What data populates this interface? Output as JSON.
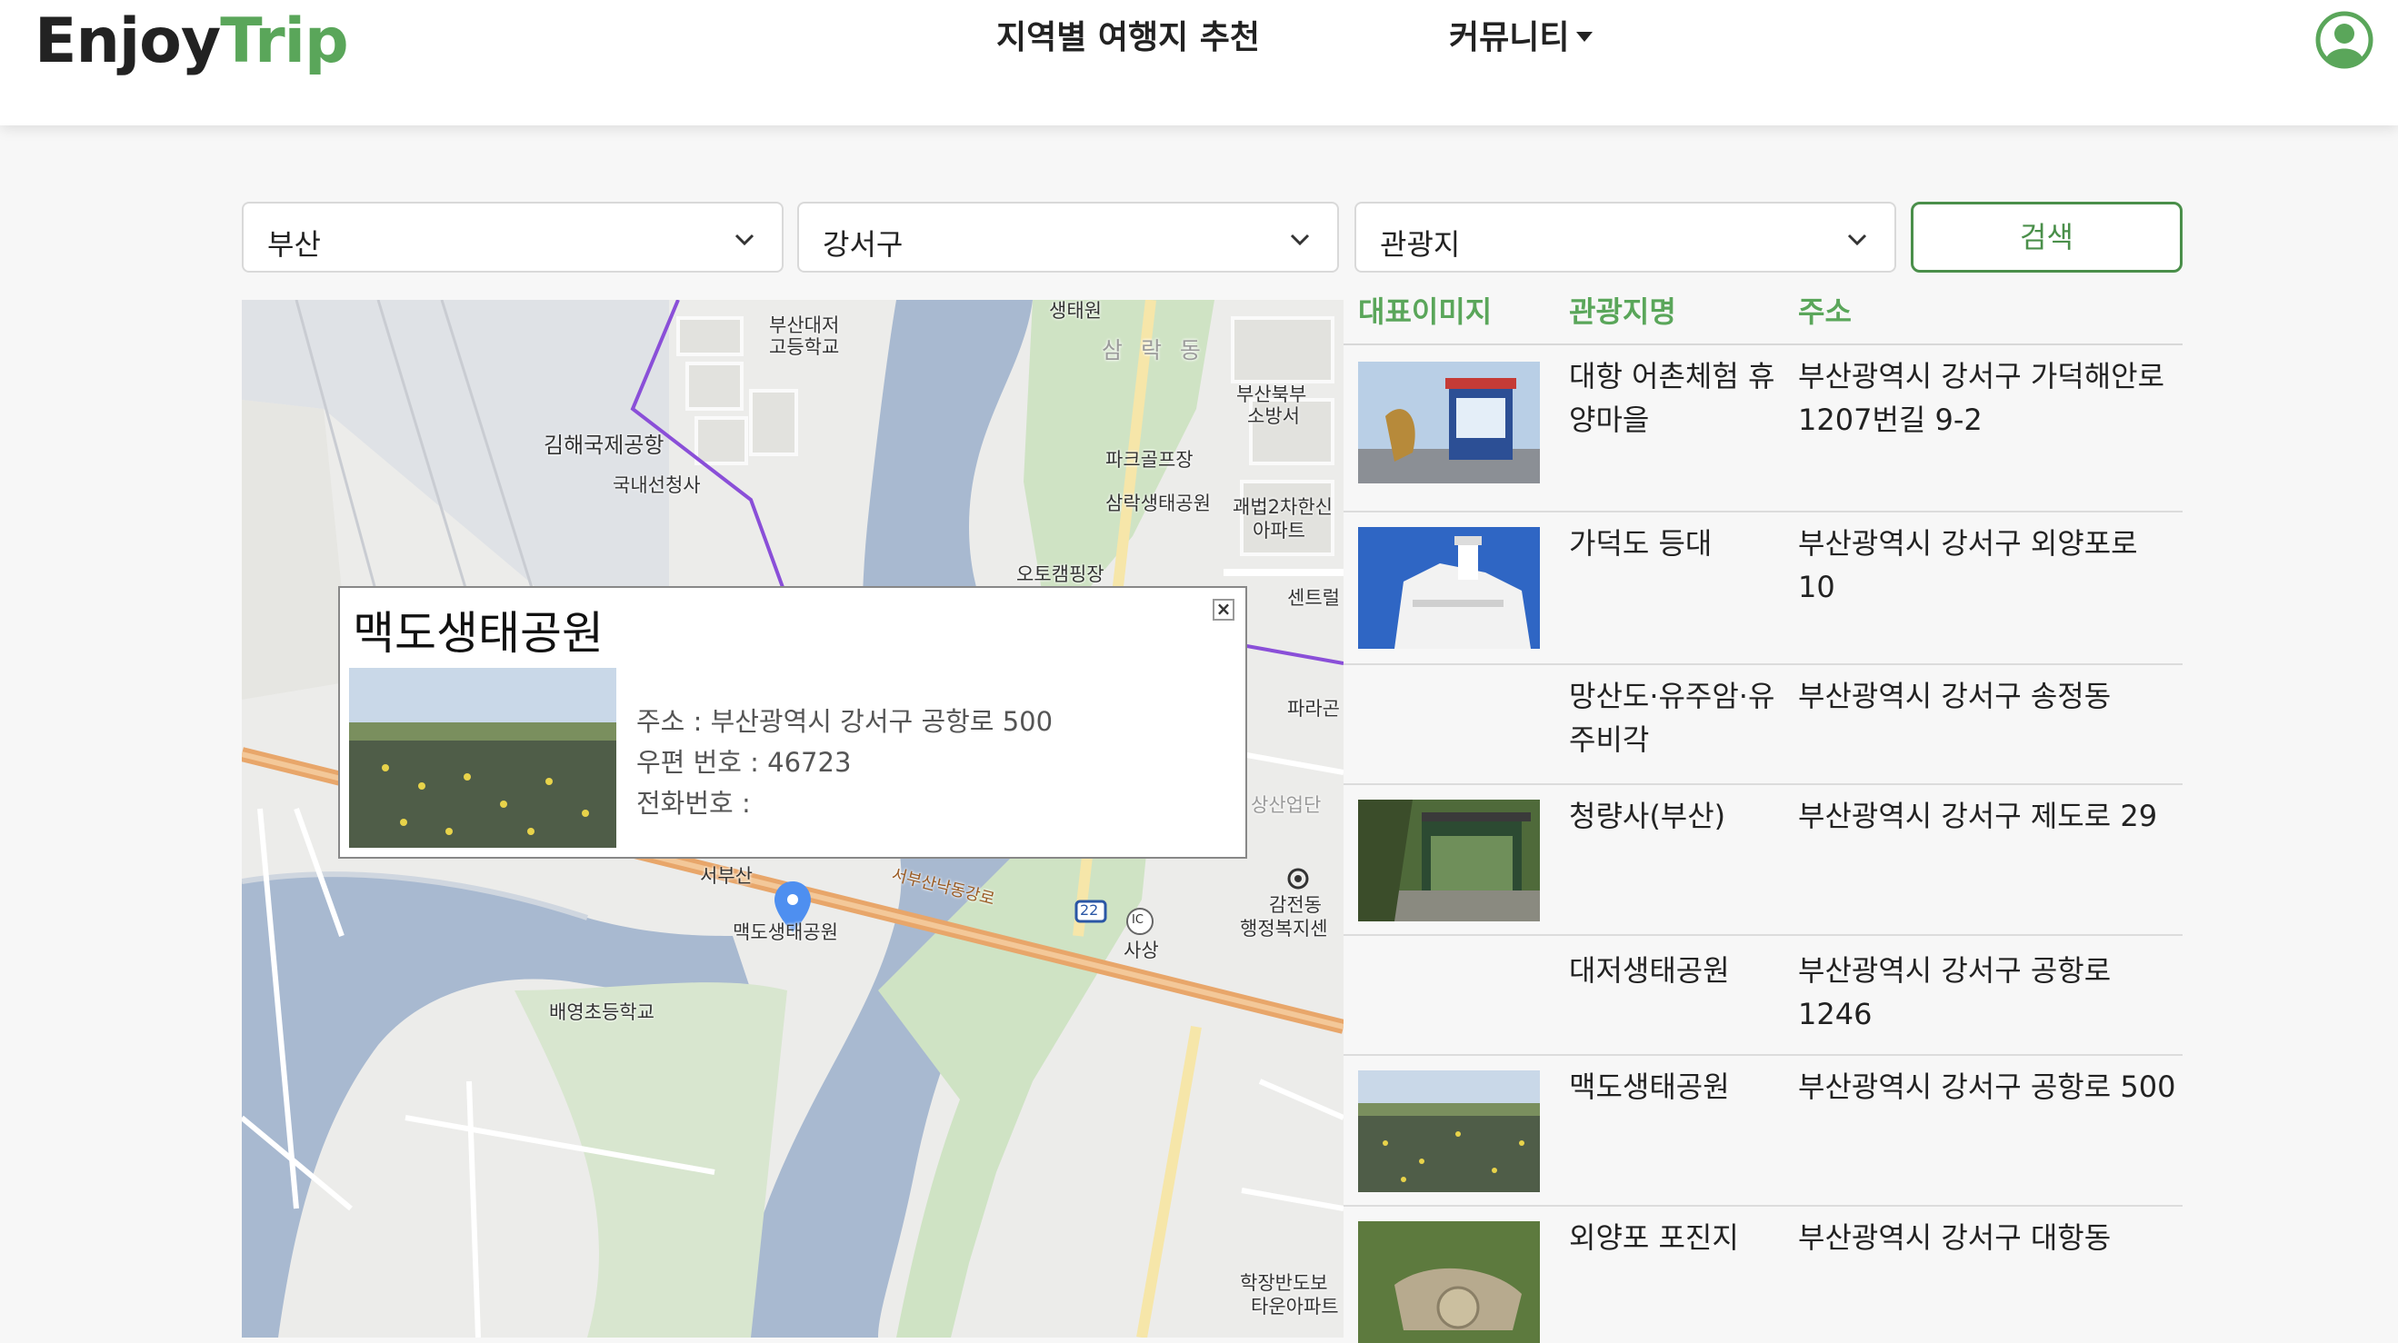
{
  "header": {
    "brand_part1": "Enjoy",
    "brand_part2": "Trip",
    "nav_region": "지역별 여행지 추천",
    "nav_community": "커뮤니티",
    "user_icon": "user-circle-icon",
    "brand_color": "#5aa65a"
  },
  "search": {
    "city": "부산",
    "district": "강서구",
    "content_type": "관광지",
    "button": "검색"
  },
  "map": {
    "labels": {
      "gimhae_airport": "김해국제공항",
      "domestic_terminal": "국내선청사",
      "daejeo_high": "부산대저",
      "daejeo_high2": "고등학교",
      "saengtae": "생태원",
      "samnak": "삼 락 동",
      "fire_station": "부산북부",
      "fire_station2": "소방서",
      "park_golf": "파크골프장",
      "samnak_park": "삼락생태공원",
      "apt": "괘법2차한신",
      "apt2": "아파트",
      "auto_camping": "오토캠핑장",
      "central": "센트럴",
      "parkang": "파라곤",
      "sangsan": "상산업단",
      "seobusan": "서부산",
      "maekdo_marker": "맥도생태공원",
      "highway": "서부산낙동강로",
      "route": "22",
      "ic": "IC",
      "sasang": "사상",
      "gamjeon": "감전동",
      "gamjeon2": "행정복지센",
      "baeyoung": "배영초등학교",
      "hakjang": "학장반도보",
      "hakjang2": "타운아파트"
    },
    "infowindow": {
      "title": "맥도생태공원",
      "address": "주소 : 부산광역시 강서구 공항로 500",
      "zipcode": "우편 번호 : 46723",
      "phone": "전화번호 :",
      "close": "×"
    }
  },
  "table": {
    "headers": [
      "대표이미지",
      "관광지명",
      "주소"
    ],
    "rows": [
      {
        "name": "대항 어촌체험 휴양마을",
        "address": "부산광역시 강서구 가덕해안로 1207번길 9-2",
        "has_image": true
      },
      {
        "name": "가덕도 등대",
        "address": "부산광역시 강서구 외양포로 10",
        "has_image": true
      },
      {
        "name": "망산도·유주암·유주비각",
        "address": "부산광역시 강서구 송정동",
        "has_image": false
      },
      {
        "name": "청량사(부산)",
        "address": "부산광역시 강서구 제도로 29",
        "has_image": true
      },
      {
        "name": "대저생태공원",
        "address": "부산광역시 강서구 공항로 1246",
        "has_image": false
      },
      {
        "name": "맥도생태공원",
        "address": "부산광역시 강서구 공항로 500",
        "has_image": true
      },
      {
        "name": "외양포 포진지",
        "address": "부산광역시 강서구 대항동",
        "has_image": true
      }
    ]
  }
}
